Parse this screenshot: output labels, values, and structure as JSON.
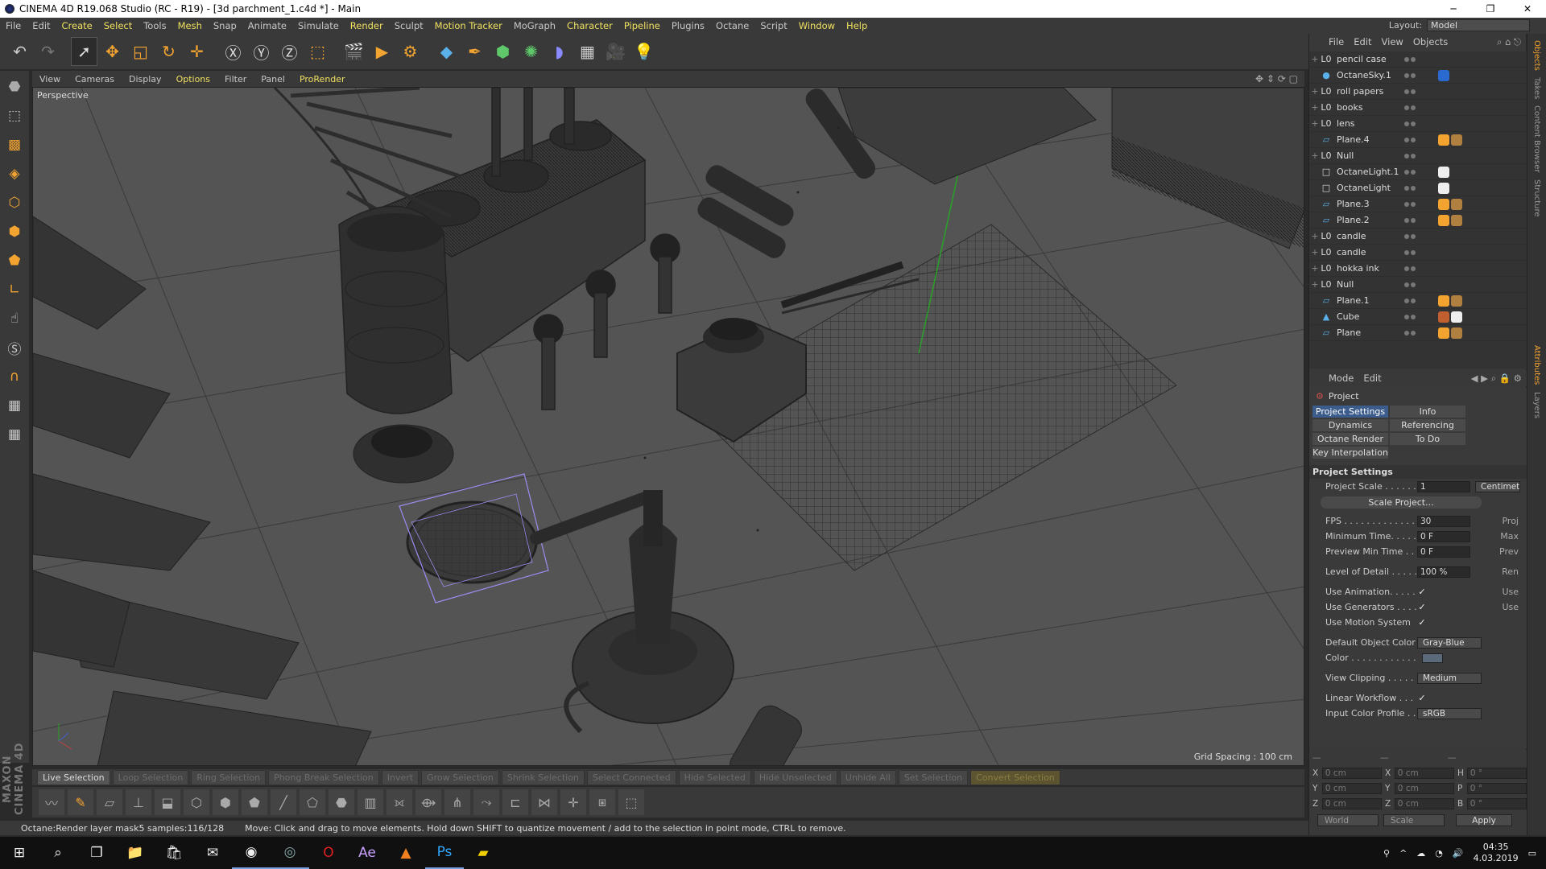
{
  "window": {
    "title": "CINEMA 4D R19.068 Studio (RC - R19) - [3d parchment_1.c4d *] - Main",
    "min": "─",
    "max": "❐",
    "close": "✕"
  },
  "menu": [
    "File",
    "Edit",
    "Create",
    "Select",
    "Tools",
    "Mesh",
    "Snap",
    "Animate",
    "Simulate",
    "Render",
    "Sculpt",
    "Motion Tracker",
    "MoGraph",
    "Character",
    "Pipeline",
    "Plugins",
    "Octane",
    "Script",
    "Window",
    "Help"
  ],
  "layout": {
    "label": "Layout:",
    "value": "Model"
  },
  "viewport": {
    "menu": [
      "View",
      "Cameras",
      "Display",
      "Options",
      "Filter",
      "Panel",
      "ProRender"
    ],
    "label": "Perspective",
    "grid_spacing": "Grid Spacing : 100 cm"
  },
  "selection_bar": [
    "Live Selection",
    "Loop Selection",
    "Ring Selection",
    "Phong Break Selection",
    "Invert",
    "Grow Selection",
    "Shrink Selection",
    "Select Connected",
    "Hide Selected",
    "Hide Unselected",
    "Unhide All",
    "Set Selection",
    "Convert Selection"
  ],
  "status": {
    "octane": "Octane:Render layer mask5 samples:116/128",
    "hint": "Move: Click and drag to move elements. Hold down SHIFT to quantize movement / add to the selection in point mode, CTRL to remove."
  },
  "maxon": "MAXON CINEMA 4D",
  "objects_menu": [
    "File",
    "Edit",
    "View",
    "Objects"
  ],
  "objects": [
    {
      "name": "pencil case",
      "type": "null",
      "expand": "+",
      "icon": "L0"
    },
    {
      "name": "OctaneSky.1",
      "type": "sky",
      "expand": "",
      "icon": "●"
    },
    {
      "name": "roll papers",
      "type": "null",
      "expand": "+",
      "icon": "L0"
    },
    {
      "name": "books",
      "type": "null",
      "expand": "+",
      "icon": "L0"
    },
    {
      "name": "lens",
      "type": "null",
      "expand": "+",
      "icon": "L0"
    },
    {
      "name": "Plane.4",
      "type": "plane",
      "expand": "",
      "icon": "▱"
    },
    {
      "name": "Null",
      "type": "null",
      "expand": "+",
      "icon": "L0"
    },
    {
      "name": "OctaneLight.1",
      "type": "light",
      "expand": "",
      "icon": "□"
    },
    {
      "name": "OctaneLight",
      "type": "light",
      "expand": "",
      "icon": "□"
    },
    {
      "name": "Plane.3",
      "type": "plane",
      "expand": "",
      "icon": "▱"
    },
    {
      "name": "Plane.2",
      "type": "plane",
      "expand": "",
      "icon": "▱"
    },
    {
      "name": "candle",
      "type": "null",
      "expand": "+",
      "icon": "L0"
    },
    {
      "name": "candle",
      "type": "null",
      "expand": "+",
      "icon": "L0"
    },
    {
      "name": "hokka ink",
      "type": "null",
      "expand": "+",
      "icon": "L0"
    },
    {
      "name": "Null",
      "type": "null",
      "expand": "+",
      "icon": "L0"
    },
    {
      "name": "Plane.1",
      "type": "plane",
      "expand": "",
      "icon": "▱"
    },
    {
      "name": "Cube",
      "type": "cube",
      "expand": "",
      "icon": "▲"
    },
    {
      "name": "Plane",
      "type": "plane",
      "expand": "",
      "icon": "▱"
    }
  ],
  "attributes": {
    "menu": [
      "Mode",
      "Edit"
    ],
    "title": "Project",
    "tabs": [
      "Project Settings",
      "Info",
      "Dynamics",
      "Referencing",
      "Octane Render",
      "To Do",
      "Key Interpolation"
    ],
    "section": "Project Settings",
    "project_scale": {
      "label": "Project Scale . . . . . . .",
      "value": "1",
      "unit": "Centimet"
    },
    "scale_button": "Scale Project...",
    "fps": {
      "label": "FPS . . . . . . . . . . . . . .",
      "value": "30",
      "extra": "Proj"
    },
    "min_time": {
      "label": "Minimum Time. . . . . .",
      "value": "0 F",
      "extra": "Max"
    },
    "preview_min": {
      "label": "Preview Min Time . . .",
      "value": "0 F",
      "extra": "Prev"
    },
    "lod": {
      "label": "Level of Detail . . . . .",
      "value": "100 %",
      "extra": "Ren"
    },
    "use_animation": {
      "label": "Use Animation. . . . .",
      "check": "✓",
      "extra": "Use"
    },
    "use_generators": {
      "label": "Use Generators . . . .",
      "check": "✓",
      "extra": "Use"
    },
    "use_motion": {
      "label": "Use Motion System",
      "check": "✓"
    },
    "default_color": {
      "label": "Default Object Color",
      "value": "Gray-Blue"
    },
    "color": {
      "label": "Color . . . . . . . . . . . ."
    },
    "view_clipping": {
      "label": "View Clipping . . . . .",
      "value": "Medium"
    },
    "linear_workflow": {
      "label": "Linear Workflow . . .",
      "check": "✓"
    },
    "input_color": {
      "label": "Input Color Profile . .",
      "value": "sRGB"
    }
  },
  "coords": {
    "x": "0 cm",
    "y": "0 cm",
    "z": "0 cm",
    "x2": "0 cm",
    "y2": "0 cm",
    "z2": "0 cm",
    "h": "0 °",
    "p": "0 °",
    "b": "0 °",
    "world": "World",
    "scale": "Scale",
    "apply": "Apply"
  },
  "side_tabs": [
    "Objects",
    "Takes",
    "Content Browser",
    "Structure",
    "Attributes",
    "Layers"
  ],
  "taskbar": {
    "time": "04:35",
    "date": "4.03.2019"
  }
}
